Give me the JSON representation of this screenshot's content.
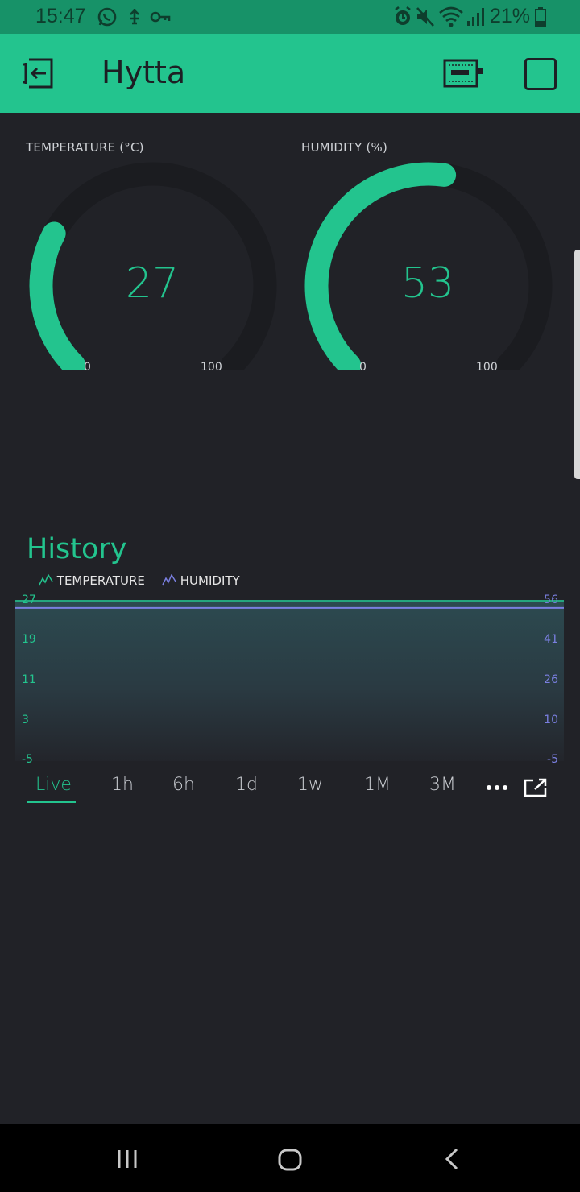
{
  "status_bar": {
    "time": "15:47",
    "battery_percent": "21%",
    "left_icons": [
      "whatsapp-icon",
      "usb-debug-icon",
      "vpn-key-icon"
    ],
    "right_icons": [
      "alarm-icon",
      "mute-icon",
      "wifi-icon",
      "signal-icon",
      "battery-icon"
    ]
  },
  "app_bar": {
    "title": "Hytta",
    "icons": [
      "exit-icon",
      "device-icon",
      "stop-icon"
    ]
  },
  "gauges": [
    {
      "label": "TEMPERATURE (°C)",
      "value": "27",
      "min": "0",
      "max": "100",
      "fraction": 0.27
    },
    {
      "label": "HUMIDITY (%)",
      "value": "53",
      "min": "0",
      "max": "100",
      "fraction": 0.53
    }
  ],
  "history": {
    "title": "History",
    "legend": [
      {
        "label": "TEMPERATURE",
        "color": "#23c48e"
      },
      {
        "label": "HUMIDITY",
        "color": "#7a7fe0"
      }
    ],
    "left_ticks": [
      "27",
      "19",
      "11",
      "3",
      "-5"
    ],
    "right_ticks": [
      "56",
      "41",
      "26",
      "10",
      "-5"
    ],
    "ranges": [
      "Live",
      "1h",
      "6h",
      "1d",
      "1w",
      "1M",
      "3M"
    ],
    "active_range": "Live"
  },
  "chart_data": {
    "type": "area",
    "series": [
      {
        "name": "TEMPERATURE",
        "axis": "left",
        "values": [
          27,
          27
        ]
      },
      {
        "name": "HUMIDITY",
        "axis": "right",
        "values": [
          53,
          53
        ]
      }
    ],
    "ylim_left": [
      -5,
      27
    ],
    "ylim_right": [
      -5,
      56
    ],
    "grid": false,
    "legend": "top-left"
  },
  "colors": {
    "accent": "#23c48e",
    "humidity": "#7a7fe0",
    "background": "#212227",
    "gauge_track": "#1b1c20",
    "status_bar": "#179268"
  },
  "nav_bar": {
    "icons": [
      "recent-apps-icon",
      "home-icon",
      "back-icon"
    ]
  }
}
